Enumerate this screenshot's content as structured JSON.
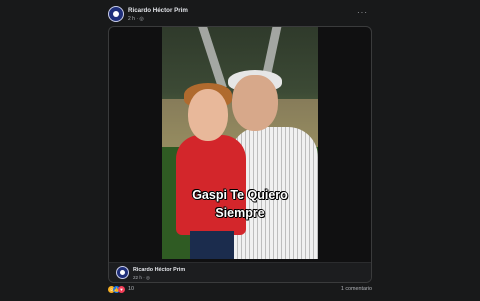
{
  "post": {
    "author": "Ricardo Héctor Prim",
    "time": "2 h · ",
    "privacy_icon": "globe-icon",
    "more_label": "···"
  },
  "image": {
    "caption_line1": "Gaspi Te Quiero",
    "caption_line2": "Siempre"
  },
  "shared": {
    "author": "Ricardo Héctor Prim",
    "time": "22 h · "
  },
  "footer": {
    "reaction_icons": [
      "haha-icon",
      "like-icon",
      "love-icon"
    ],
    "reaction_count": "10",
    "comment_count": "1 comentario"
  },
  "colors": {
    "background": "#18191a",
    "text": "#e4e6eb",
    "muted": "#b0b3b8",
    "like": "#1877f2",
    "love": "#f33e58",
    "haha": "#f7b125"
  }
}
